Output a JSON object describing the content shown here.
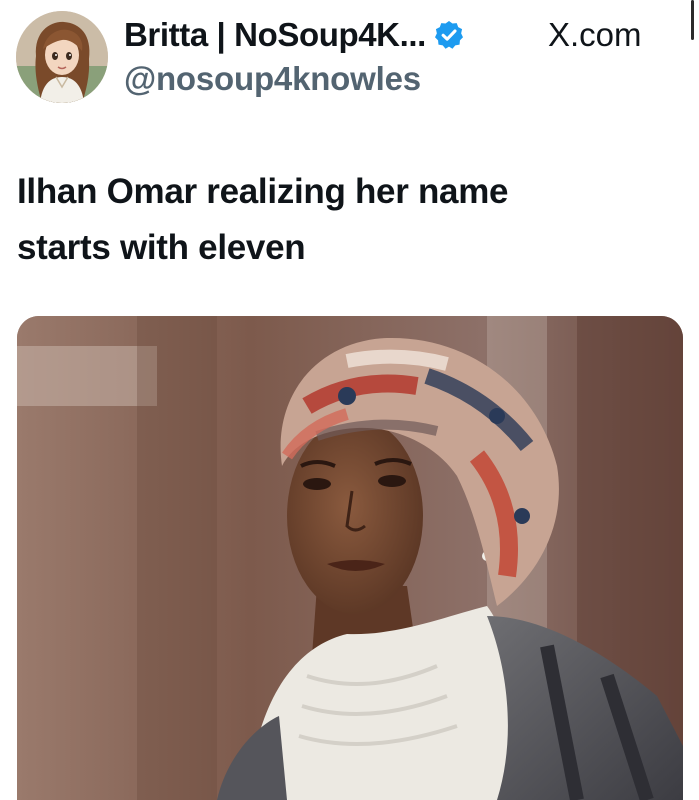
{
  "tweet": {
    "author": {
      "display_name": "Britta | NoSoup4K...",
      "handle": "@nosoup4knowles",
      "verified": true,
      "avatar_icon": "anime-avatar"
    },
    "source": "X.com",
    "text_line_1": "Ilhan Omar realizing her name",
    "text_line_2": "starts with eleven",
    "media": {
      "kind": "photo"
    }
  },
  "colors": {
    "text": "#0f1419",
    "secondary_text": "#536471",
    "verified_blue": "#1d9bf0",
    "background": "#ffffff"
  }
}
